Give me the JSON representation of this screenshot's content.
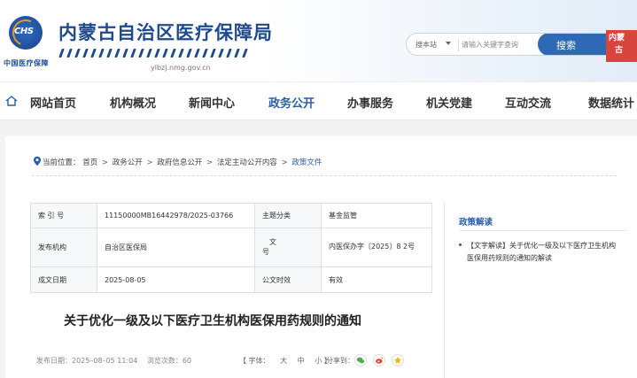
{
  "header": {
    "logo_text": "CHS",
    "logo_subtitle": "中国医疗保障",
    "site_title": "内蒙古自治区医疗保障局",
    "site_url": "ylbzj.nmg.gov.cn",
    "search": {
      "scope": "搜本站",
      "placeholder": "请输入关键字查询",
      "button_label": "搜索"
    },
    "seal_text": [
      "内蒙",
      "古"
    ]
  },
  "nav": {
    "items": [
      {
        "label": "网站首页",
        "active": false
      },
      {
        "label": "机构概况",
        "active": false
      },
      {
        "label": "新闻中心",
        "active": false
      },
      {
        "label": "政务公开",
        "active": true
      },
      {
        "label": "办事服务",
        "active": false
      },
      {
        "label": "机关党建",
        "active": false
      },
      {
        "label": "互动交流",
        "active": false
      },
      {
        "label": "数据统计",
        "active": false
      }
    ]
  },
  "breadcrumb": {
    "prefix": "当前位置：",
    "items": [
      "首页",
      "政务公开",
      "政府信息公开",
      "法定主动公开内容"
    ],
    "current": "政策文件",
    "separator": ">"
  },
  "meta": {
    "index_label": "索 引 号",
    "index_value": "11150000MB16442978/2025-03766",
    "category_label": "主题分类",
    "category_value": "基金监管",
    "issuer_label": "发布机构",
    "issuer_value": "自治区医保局",
    "docno_label": "文 号",
    "docno_value": "内医保办字〔2025〕8 2号",
    "date_label": "成文日期",
    "date_value": "2025-08-05",
    "validity_label": "公文时效",
    "validity_value": "有效"
  },
  "document": {
    "title": "关于优化一级及以下医疗卫生机构医保用药规则的通知",
    "publish_label": "发布日期：",
    "publish_date": "2025–08–05 11:04",
    "views_label": "浏览次数：",
    "views": "60",
    "font_label": "【 字体：",
    "font_large": "大",
    "font_medium": "中",
    "font_small": "小",
    "font_close": "】",
    "share_label": "分享到："
  },
  "sidebar": {
    "title": "政策解读",
    "links": [
      "【文字解读】关于优化一级及以下医疗卫生机构医保用药规则的通知的解读"
    ]
  },
  "colors": {
    "brand_blue": "#2a5ea8",
    "search_button": "#2f69b4",
    "seal_red": "#d8453c",
    "wechat_green": "#4caf50",
    "weibo_red": "#e0463c",
    "favorite_yellow": "#f4b400"
  }
}
